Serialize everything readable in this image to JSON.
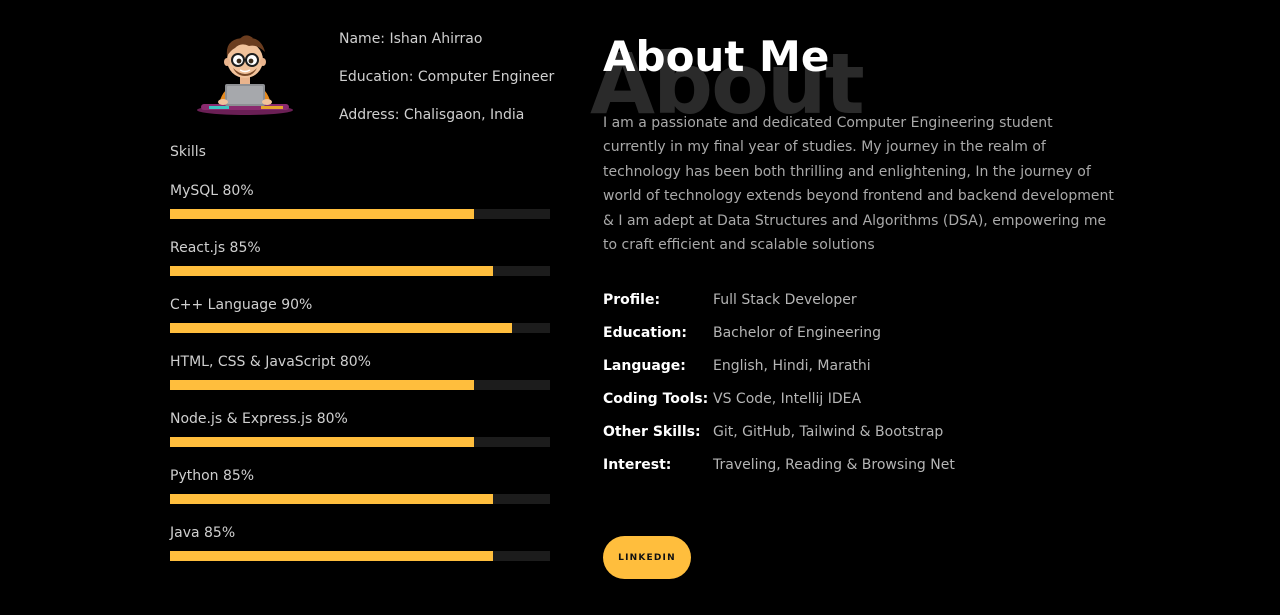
{
  "profile_card": {
    "name_line": "Name: Ishan Ahirrao",
    "education_line": "Education: Computer Engineer",
    "address_line": "Address: Chalisgaon, India"
  },
  "skills": {
    "title": "Skills",
    "items": [
      {
        "label": "MySQL 80%",
        "percent": 80
      },
      {
        "label": "React.js 85%",
        "percent": 85
      },
      {
        "label": "C++ Language 90%",
        "percent": 90
      },
      {
        "label": "HTML, CSS & JavaScript 80%",
        "percent": 80
      },
      {
        "label": "Node.js & Express.js 80%",
        "percent": 80
      },
      {
        "label": "Python 85%",
        "percent": 85
      },
      {
        "label": "Java 85%",
        "percent": 85
      }
    ]
  },
  "about": {
    "background_text": "About",
    "title": "About Me",
    "bio": "I am a passionate and dedicated Computer Engineering student currently in my final year of studies. My journey in the realm of technology has been both thrilling and enlightening, In the journey of world of technology extends beyond frontend and backend development & I am adept at Data Structures and Algorithms (DSA), empowering me to craft efficient and scalable solutions"
  },
  "details": [
    {
      "key": "Profile:",
      "value": "Full Stack Developer"
    },
    {
      "key": "Education:",
      "value": "Bachelor of Engineering"
    },
    {
      "key": "Language:",
      "value": "English, Hindi, Marathi"
    },
    {
      "key": "Coding Tools:",
      "value": "VS Code, Intellij IDEA"
    },
    {
      "key": "Other Skills:",
      "value": "Git, GitHub, Tailwind & Bootstrap"
    },
    {
      "key": "Interest:",
      "value": "Traveling, Reading & Browsing Net"
    }
  ],
  "linkedin_button": {
    "label": "LINKEDIN"
  },
  "colors": {
    "accent": "#ffbe3d",
    "background": "#000000",
    "track": "#1c1c1c"
  },
  "icons": {
    "avatar": "developer-avatar-illustration"
  }
}
